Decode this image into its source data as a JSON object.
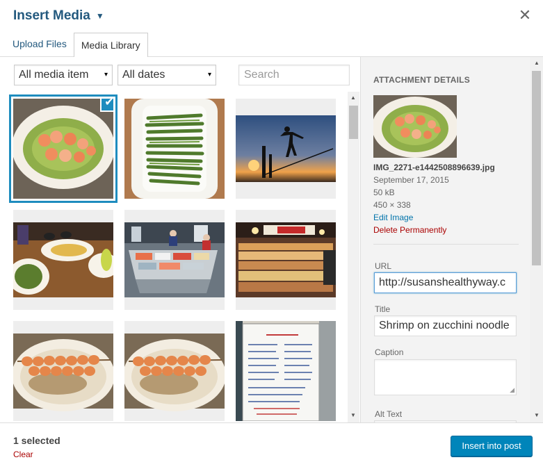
{
  "modal": {
    "title": "Insert Media",
    "title_caret": "▼",
    "close_glyph": "✕",
    "icons": {
      "close": "close-icon",
      "caret": "caret-down-icon",
      "check": "check-icon"
    }
  },
  "tabs": [
    {
      "label": "Upload Files",
      "active": false
    },
    {
      "label": "Media Library",
      "active": true
    }
  ],
  "filters": {
    "type_select": {
      "selected": "All media item",
      "arrow": "▾"
    },
    "date_select": {
      "selected": "All dates",
      "arrow": "▾"
    },
    "search_placeholder": "Search"
  },
  "grid": {
    "items": [
      {
        "name": "shrimp-zucchini-noodles",
        "selected": true
      },
      {
        "name": "asparagus-plate",
        "selected": false
      },
      {
        "name": "silhouette-sunset",
        "selected": false
      },
      {
        "name": "restaurant-table",
        "selected": false
      },
      {
        "name": "fish-market-counter",
        "selected": false
      },
      {
        "name": "market-stalls",
        "selected": false
      },
      {
        "name": "shrimp-skewers-1",
        "selected": false
      },
      {
        "name": "shrimp-skewers-2",
        "selected": false
      },
      {
        "name": "menu-board",
        "selected": false
      }
    ],
    "check_glyph": "✔"
  },
  "details": {
    "heading": "ATTACHMENT DETAILS",
    "filename": "IMG_2271-e1442508896639.jpg",
    "date": "September 17, 2015",
    "size": "50 kB",
    "dimensions": "450 × 338",
    "edit_link": "Edit Image",
    "delete_link": "Delete Permanently",
    "url_label": "URL",
    "url_value": "http://susanshealthyway.c",
    "title_label": "Title",
    "title_value": "Shrimp on zucchini noodle",
    "caption_label": "Caption",
    "caption_value": "",
    "alt_label": "Alt Text"
  },
  "scroll": {
    "up": "▲",
    "down": "▼"
  },
  "footer": {
    "selected_count": "1 selected",
    "clear": "Clear",
    "insert_button": "Insert into post"
  },
  "colors": {
    "accent": "#1e8cbe",
    "button": "#0085ba",
    "title": "#23597e",
    "danger": "#a00"
  }
}
